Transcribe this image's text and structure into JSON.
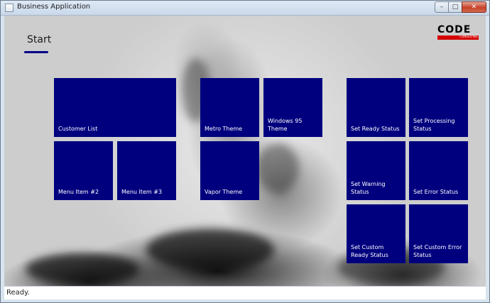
{
  "window": {
    "title": "Business Application",
    "min_glyph": "–",
    "max_glyph": "□",
    "close_glyph": "✕"
  },
  "page": {
    "title": "Start"
  },
  "logo": {
    "word": "CODE",
    "sub": "CONSULTING"
  },
  "tiles": [
    {
      "label": "Customer List"
    },
    {
      "label": "Menu Item #2"
    },
    {
      "label": "Menu Item #3"
    },
    {
      "label": "Metro Theme"
    },
    {
      "label": "Windows 95 Theme"
    },
    {
      "label": "Vapor Theme"
    },
    {
      "label": "Set Ready Status"
    },
    {
      "label": "Set Processing Status"
    },
    {
      "label": "Set Warning Status"
    },
    {
      "label": "Set Error Status"
    },
    {
      "label": "Set Custom Ready Status"
    },
    {
      "label": "Set Custom Error Status"
    }
  ],
  "status": {
    "text": "Ready."
  },
  "colors": {
    "tile": "#00007f",
    "accent_underline": "#000088",
    "logo_red": "#d40000"
  }
}
